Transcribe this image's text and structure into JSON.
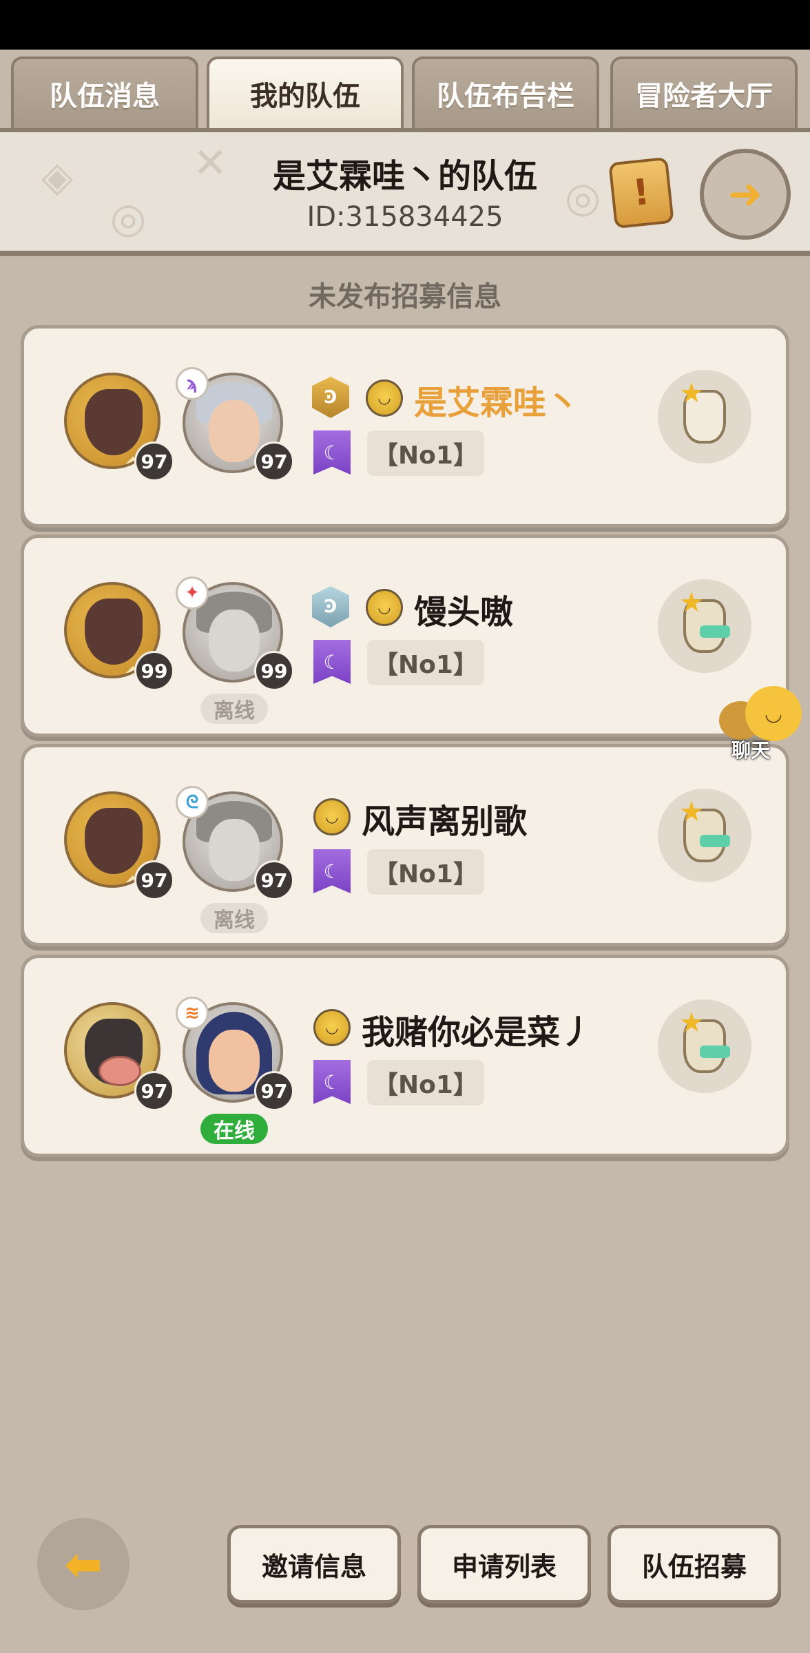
{
  "tabs": [
    {
      "label": "队伍消息",
      "active": false
    },
    {
      "label": "我的队伍",
      "active": true
    },
    {
      "label": "队伍布告栏",
      "active": false
    },
    {
      "label": "冒险者大厅",
      "active": false
    }
  ],
  "header": {
    "team_name": "是艾霖哇丶的队伍",
    "team_id": "ID:315834425",
    "scroll_icon": "!"
  },
  "recruit_status": "未发布招募信息",
  "members": [
    {
      "pet_level": "97",
      "avatar_level": "97",
      "element_icon": "ϡ",
      "rank_icon": "Ͽ",
      "name": "是艾霖哇丶",
      "guild": "【No1】",
      "status": ""
    },
    {
      "pet_level": "99",
      "avatar_level": "99",
      "element_icon": "✦",
      "rank_icon": "Ͽ",
      "name": "馒头嗷",
      "guild": "【No1】",
      "status": "离线"
    },
    {
      "pet_level": "97",
      "avatar_level": "97",
      "element_icon": "ᘓ",
      "rank_icon": "",
      "name": "风声离别歌",
      "guild": "【No1】",
      "status": "离线"
    },
    {
      "pet_level": "97",
      "avatar_level": "97",
      "element_icon": "≋",
      "rank_icon": "",
      "name": "我赌你必是菜丿",
      "guild": "【No1】",
      "status": "在线"
    }
  ],
  "chat": {
    "label": "聊天"
  },
  "bottom": {
    "invite_label": "邀请信息",
    "apply_label": "申请列表",
    "recruit_label": "队伍招募"
  },
  "colors": {
    "self_name": "#e8a13a",
    "online": "#2fae3c",
    "offline_bg": "#e3dcd2"
  }
}
